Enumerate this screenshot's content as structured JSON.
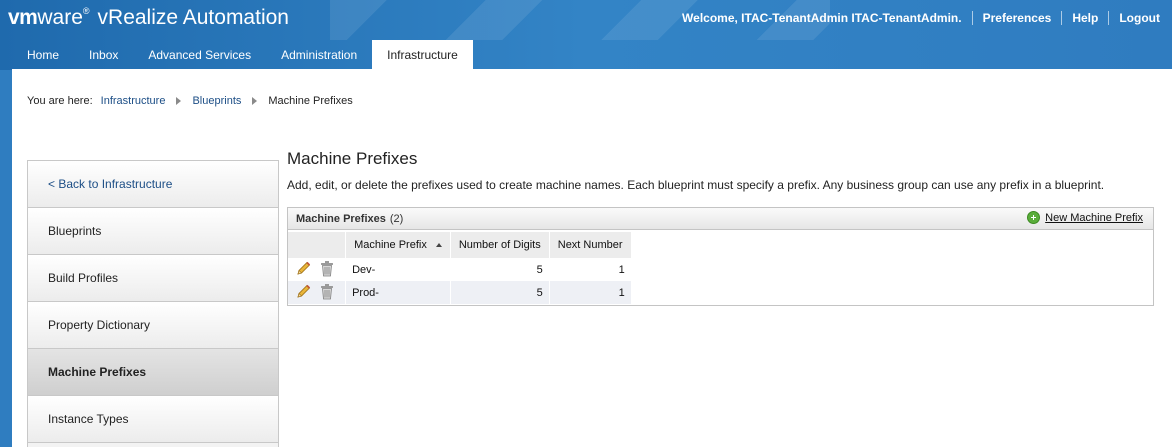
{
  "header": {
    "logo_vm": "vm",
    "logo_ware": "ware",
    "logo_reg": "®",
    "product": "vRealize Automation",
    "welcome": "Welcome, ITAC-TenantAdmin ITAC-TenantAdmin.",
    "preferences": "Preferences",
    "help": "Help",
    "logout": "Logout"
  },
  "tabs": [
    {
      "label": "Home"
    },
    {
      "label": "Inbox"
    },
    {
      "label": "Advanced Services"
    },
    {
      "label": "Administration"
    },
    {
      "label": "Infrastructure",
      "active": true
    }
  ],
  "breadcrumb": {
    "label": "You are here:",
    "items": [
      "Infrastructure",
      "Blueprints",
      "Machine Prefixes"
    ]
  },
  "sidebar": {
    "items": [
      {
        "label": "< Back to Infrastructure"
      },
      {
        "label": "Blueprints"
      },
      {
        "label": "Build Profiles"
      },
      {
        "label": "Property Dictionary"
      },
      {
        "label": "Machine Prefixes",
        "active": true
      },
      {
        "label": "Instance Types"
      }
    ]
  },
  "main": {
    "title": "Machine Prefixes",
    "description": "Add, edit, or delete the prefixes used to create machine names. Each blueprint must specify a prefix. Any business group can use any prefix in a blueprint.",
    "grid": {
      "title": "Machine Prefixes",
      "count": "(2)",
      "new_button": "New Machine Prefix",
      "columns": [
        "Machine Prefix",
        "Number of Digits",
        "Next Number"
      ],
      "rows": [
        {
          "prefix": "Dev-",
          "digits": "5",
          "next": "1"
        },
        {
          "prefix": "Prod-",
          "digits": "5",
          "next": "1"
        }
      ]
    }
  },
  "colors": {
    "header_blue": "#2f7dc0",
    "link_blue": "#1c4e86",
    "add_green": "#5aad3a"
  },
  "icons": [
    "pencil-icon",
    "trash-icon",
    "plus-circle-icon",
    "sort-ascending-icon",
    "breadcrumb-arrow-icon"
  ]
}
